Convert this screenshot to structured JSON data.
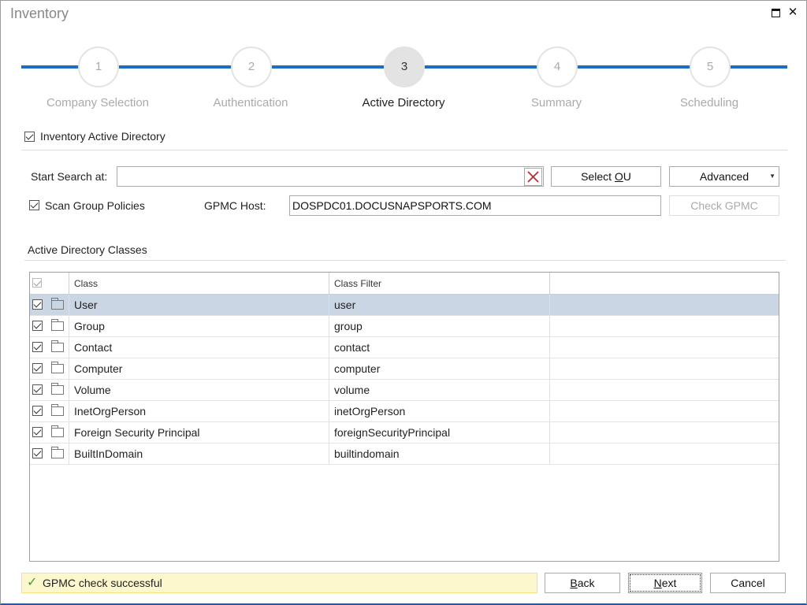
{
  "window": {
    "title": "Inventory",
    "maximize_icon": "maximize-icon",
    "close_icon": "close-icon",
    "close_glyph": "✕"
  },
  "stepper": {
    "steps": [
      {
        "number": "1",
        "label": "Company Selection",
        "state": "inactive"
      },
      {
        "number": "2",
        "label": "Authentication",
        "state": "inactive"
      },
      {
        "number": "3",
        "label": "Active Directory",
        "state": "active"
      },
      {
        "number": "4",
        "label": "Summary",
        "state": "inactive"
      },
      {
        "number": "5",
        "label": "Scheduling",
        "state": "inactive"
      }
    ],
    "line_color": "#1b6ec2"
  },
  "options": {
    "inventory_ad_label": "Inventory Active Directory",
    "inventory_ad_checked": true,
    "start_search_label": "Start Search at:",
    "start_search_value": "",
    "select_ou_prefix": "Select ",
    "select_ou_mnemonic": "O",
    "select_ou_suffix": "U",
    "advanced_label": "Advanced",
    "advanced_arrow": "▼",
    "scan_gp_label": "Scan Group Policies",
    "scan_gp_checked": true,
    "gpmc_host_label": "GPMC Host:",
    "gpmc_host_value": "DOSPDC01.DOCUSNAPSPORTS.COM",
    "check_gpmc_label": "Check GPMC"
  },
  "classes": {
    "section_title": "Active Directory Classes",
    "columns": [
      "Class",
      "Class Filter"
    ],
    "rows": [
      {
        "class": "User",
        "filter": "user",
        "checked": true,
        "selected": true
      },
      {
        "class": "Group",
        "filter": "group",
        "checked": true,
        "selected": false
      },
      {
        "class": "Contact",
        "filter": "contact",
        "checked": true,
        "selected": false
      },
      {
        "class": "Computer",
        "filter": "computer",
        "checked": true,
        "selected": false
      },
      {
        "class": "Volume",
        "filter": "volume",
        "checked": true,
        "selected": false
      },
      {
        "class": "InetOrgPerson",
        "filter": "inetOrgPerson",
        "checked": true,
        "selected": false
      },
      {
        "class": "Foreign Security Principal",
        "filter": "foreignSecurityPrincipal",
        "checked": true,
        "selected": false
      },
      {
        "class": "BuiltInDomain",
        "filter": "builtindomain",
        "checked": true,
        "selected": false
      }
    ]
  },
  "footer": {
    "status_icon": "✓",
    "status_text": "GPMC check successful",
    "back_mnemonic": "B",
    "back_rest": "ack",
    "next_mnemonic": "N",
    "next_rest": "ext",
    "cancel_label": "Cancel"
  }
}
